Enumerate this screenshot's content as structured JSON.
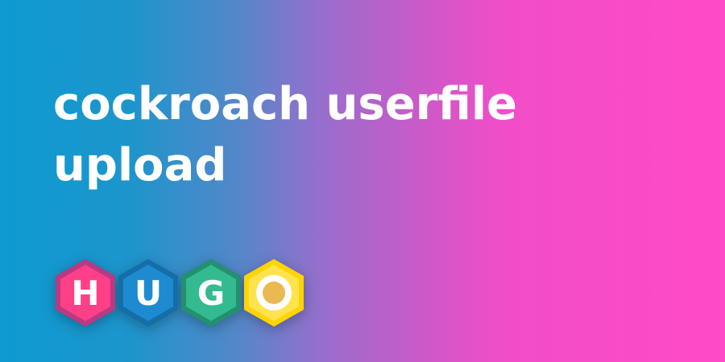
{
  "title": "cockroach userfile upload",
  "logo": {
    "icon": "hugo-logo-icon",
    "letters": [
      "H",
      "U",
      "G",
      "O"
    ],
    "colors": {
      "h": "#ff4088",
      "u": "#1e8bd0",
      "g": "#33ba91",
      "o": "#ebb951"
    }
  }
}
